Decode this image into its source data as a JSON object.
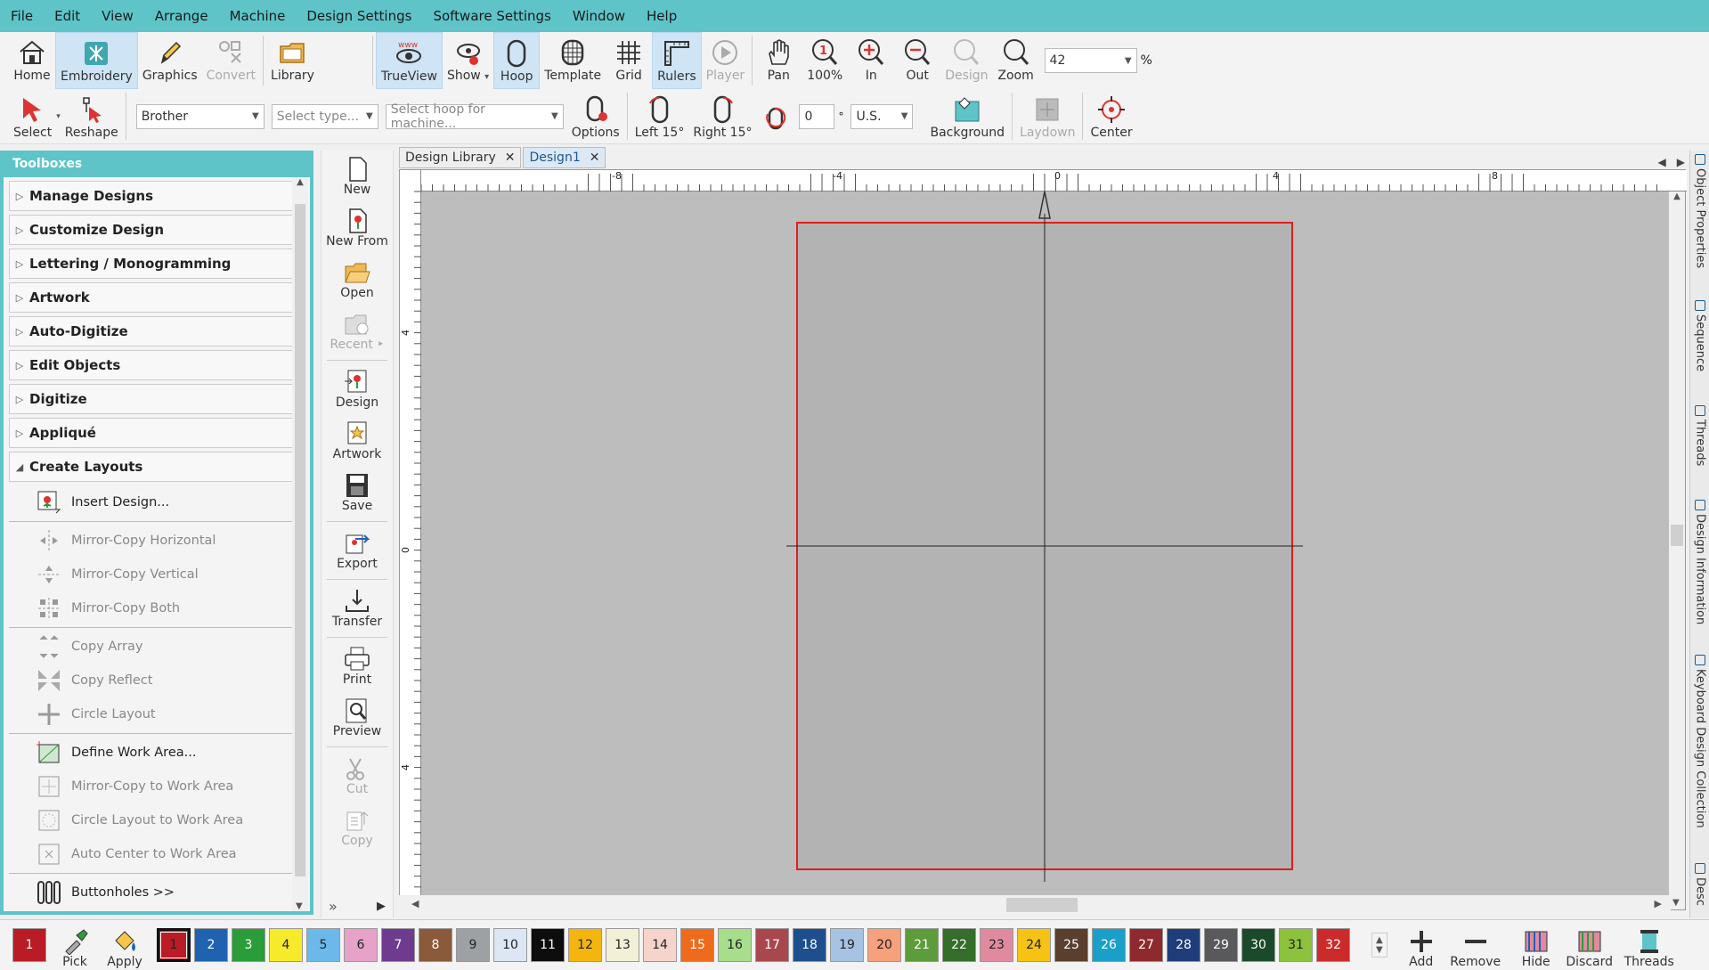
{
  "menu": [
    "File",
    "Edit",
    "View",
    "Arrange",
    "Machine",
    "Design Settings",
    "Software Settings",
    "Window",
    "Help"
  ],
  "ribbon1": {
    "home": "Home",
    "embroidery": "Embroidery",
    "graphics": "Graphics",
    "convert": "Convert",
    "library": "Library",
    "trueview": "TrueView",
    "show": "Show",
    "hoop": "Hoop",
    "template": "Template",
    "grid": "Grid",
    "rulers": "Rulers",
    "player": "Player",
    "pan": "Pan",
    "zoom100": "100%",
    "zoom_in": "In",
    "zoom_out": "Out",
    "zoom_design": "Design",
    "zoom": "Zoom",
    "zoom_value": "42",
    "zoom_unit": "%"
  },
  "ribbon2": {
    "select": "Select",
    "reshape": "Reshape",
    "machine_value": "Brother",
    "type_placeholder": "Select type...",
    "hoop_placeholder": "Select hoop for machine...",
    "options": "Options",
    "left15": "Left 15°",
    "right15": "Right 15°",
    "rotation_value": "0",
    "degree": "°",
    "units": "U.S.",
    "background": "Background",
    "laydown": "Laydown",
    "center": "Center"
  },
  "toolbox": {
    "title": "Toolboxes",
    "sections": [
      "Manage Designs",
      "Customize Design",
      "Lettering / Monogramming",
      "Artwork",
      "Auto-Digitize",
      "Edit Objects",
      "Digitize",
      "Appliqué"
    ],
    "open_section": "Create Layouts",
    "items": {
      "insert_design": "Insert Design...",
      "mirror_h": "Mirror-Copy Horizontal",
      "mirror_v": "Mirror-Copy Vertical",
      "mirror_both": "Mirror-Copy Both",
      "copy_array": "Copy Array",
      "copy_reflect": "Copy Reflect",
      "circle_layout": "Circle Layout",
      "define_work_area": "Define Work Area...",
      "mirror_work_area": "Mirror-Copy to Work Area",
      "circle_work_area": "Circle Layout to Work Area",
      "auto_center": "Auto Center to Work Area",
      "buttonholes": "Buttonholes >>"
    }
  },
  "vtool": {
    "new": "New",
    "new_from": "New From",
    "open": "Open",
    "recent": "Recent",
    "recent_arrow": "‣",
    "design": "Design",
    "artwork": "Artwork",
    "save": "Save",
    "export": "Export",
    "transfer": "Transfer",
    "print": "Print",
    "preview": "Preview",
    "cut": "Cut",
    "copy": "Copy",
    "more": "»",
    "expand": "▶"
  },
  "tabs": {
    "library": "Design Library",
    "design1": "Design1",
    "close": "✕"
  },
  "ruler": {
    "top": [
      "-8",
      "-4",
      "0",
      "4",
      "8"
    ],
    "left": [
      "4",
      "0",
      "4"
    ]
  },
  "palette": {
    "current": "1",
    "pick": "Pick",
    "apply": "Apply",
    "swatches": [
      "1",
      "2",
      "3",
      "4",
      "5",
      "6",
      "7",
      "8",
      "9",
      "10",
      "11",
      "12",
      "13",
      "14",
      "15",
      "16",
      "17",
      "18",
      "19",
      "20",
      "21",
      "22",
      "23",
      "24",
      "25",
      "26",
      "27",
      "28",
      "29",
      "30",
      "31",
      "32"
    ],
    "colors": [
      "#b91c24",
      "#1f63b0",
      "#2a9d3a",
      "#f7ea2a",
      "#6cb8ea",
      "#e6a2c8",
      "#6e3b8e",
      "#8a5a3a",
      "#9ea1a3",
      "#dde6f4",
      "#0d0d0d",
      "#f4b50f",
      "#f2f0d6",
      "#f6d4cc",
      "#ef6b1c",
      "#a6de8c",
      "#a8484e",
      "#1d4f8e",
      "#a7c3e4",
      "#f6a07c",
      "#5c9c3a",
      "#346e2a",
      "#e08aa0",
      "#f6c315",
      "#5a3e2e",
      "#1aa0c8",
      "#8e2a2e",
      "#1e3d7a",
      "#59595b",
      "#1b4a2a",
      "#8cc23c",
      "#cc2b2b"
    ],
    "add": "Add",
    "remove": "Remove",
    "hide": "Hide",
    "discard": "Discard",
    "threads": "Threads"
  },
  "sidebar": [
    "Object Properties",
    "Sequence",
    "Threads",
    "Design Information",
    "Keyboard Design Collection",
    "Desc"
  ],
  "colors": {
    "accent": "#5ec4c8",
    "hoop": "#e11d1d",
    "canvas": "#bdbdbd",
    "hoop_fill": "#b3b3b3"
  }
}
